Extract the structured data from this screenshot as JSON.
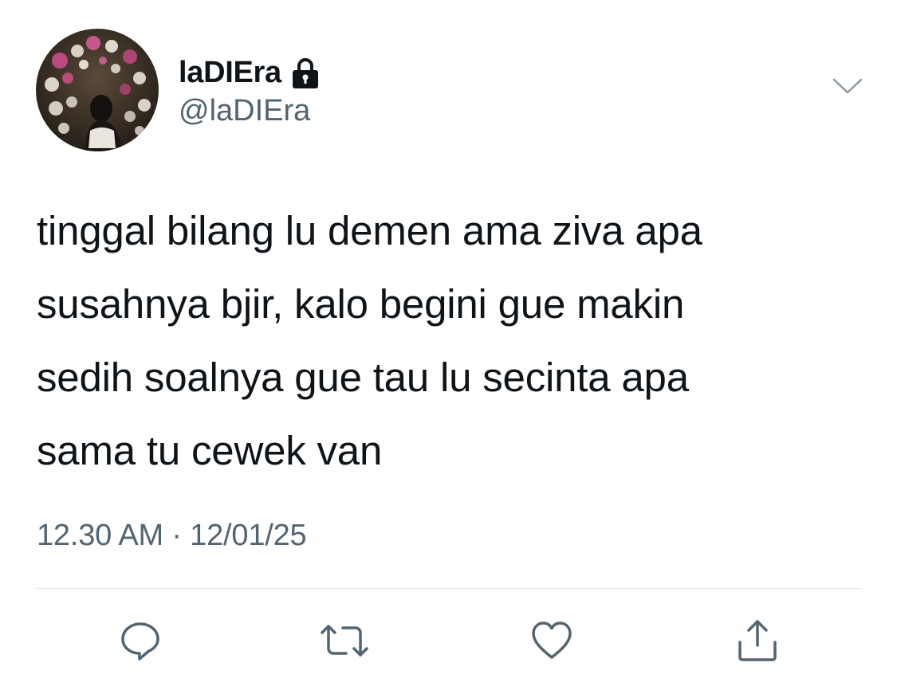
{
  "author": {
    "display_name": "laDIEra",
    "handle": "@laDIEra",
    "protected_icon": "lock-icon",
    "avatar": "profile-photo"
  },
  "tweet": {
    "lines": [
      "tinggal bilang lu demen ama ziva apa",
      "susahnya bjir, kalo begini gue makin",
      "sedih soalnya gue tau lu secinta apa",
      "sama tu cewek van"
    ],
    "time": "12.30 AM",
    "separator": "·",
    "date": "12/01/25"
  },
  "actions": [
    {
      "name": "reply",
      "icon": "reply-bubble-icon"
    },
    {
      "name": "retweet",
      "icon": "retweet-icon"
    },
    {
      "name": "like",
      "icon": "heart-icon"
    },
    {
      "name": "share",
      "icon": "share-icon"
    }
  ],
  "colors": {
    "text_primary": "#0f1419",
    "text_secondary": "#536471",
    "icon": "#536471",
    "divider": "#e1e5e8",
    "background": "#ffffff"
  }
}
